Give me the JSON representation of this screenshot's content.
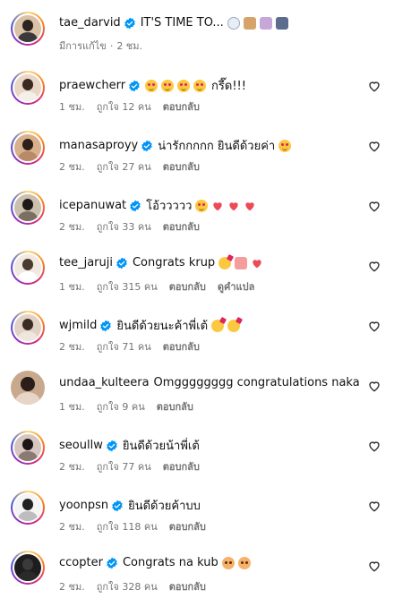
{
  "caption": {
    "username": "tae_darvid",
    "text": "IT'S TIME TO...",
    "edited": "มีการแก้ไข",
    "time": "2 ชม.",
    "emojis": [
      "ring",
      "couple",
      "bride",
      "groom"
    ]
  },
  "comments": [
    {
      "username": "praewcherr",
      "verified": true,
      "text": "กรี๊ด!!!",
      "emojis_before": [
        "face",
        "face",
        "face",
        "face"
      ],
      "emojis_after": [],
      "time": "1 ชม.",
      "likes": "ถูกใจ 12 คน",
      "reply": "ตอบกลับ",
      "translate": ""
    },
    {
      "username": "manasaproyy",
      "verified": true,
      "text": "น่ารักกกกก ยินดีด้วยค่า",
      "emojis_before": [],
      "emojis_after": [
        "face"
      ],
      "time": "2 ชม.",
      "likes": "ถูกใจ 27 คน",
      "reply": "ตอบกลับ",
      "translate": ""
    },
    {
      "username": "icepanuwat",
      "verified": true,
      "text": "โอ้ววววว",
      "emojis_before": [],
      "emojis_after": [
        "face",
        "heart",
        "heart",
        "heart"
      ],
      "time": "2 ชม.",
      "likes": "ถูกใจ 33 คน",
      "reply": "ตอบกลับ",
      "translate": ""
    },
    {
      "username": "tee_jaruji",
      "verified": true,
      "text": "Congrats krup",
      "emojis_before": [],
      "emojis_after": [
        "party",
        "kiss",
        "heart"
      ],
      "time": "1 ชม.",
      "likes": "ถูกใจ 315 คน",
      "reply": "ตอบกลับ",
      "translate": "ดูคำแปล"
    },
    {
      "username": "wjmild",
      "verified": true,
      "text": "ยินดีด้วยนะค้าพี่เต้",
      "emojis_before": [],
      "emojis_after": [
        "party",
        "party"
      ],
      "time": "2 ชม.",
      "likes": "ถูกใจ 71 คน",
      "reply": "ตอบกลับ",
      "translate": ""
    },
    {
      "username": "undaa_kulteera",
      "verified": false,
      "text": "Omgggggggg congratulations naka",
      "emojis_before": [],
      "emojis_after": [],
      "time": "1 ชม.",
      "likes": "ถูกใจ 9 คน",
      "reply": "ตอบกลับ",
      "translate": ""
    },
    {
      "username": "seoullw",
      "verified": true,
      "text": "ยินดีด้วยน้าพี่เต้",
      "emojis_before": [],
      "emojis_after": [],
      "time": "2 ชม.",
      "likes": "ถูกใจ 77 คน",
      "reply": "ตอบกลับ",
      "translate": ""
    },
    {
      "username": "yoonpsn",
      "verified": true,
      "text": "ยินดีด้วยค้าบบ",
      "emojis_before": [],
      "emojis_after": [],
      "time": "2 ชม.",
      "likes": "ถูกใจ 118 คน",
      "reply": "ตอบกลับ",
      "translate": ""
    },
    {
      "username": "ccopter",
      "verified": true,
      "text": "Congrats na kub",
      "emojis_before": [],
      "emojis_after": [
        "flush",
        "flush"
      ],
      "time": "2 ชม.",
      "likes": "ถูกใจ 328 คน",
      "reply": "ตอบกลับ",
      "translate": ""
    }
  ],
  "colors": {
    "verified_blue": "#0095f6",
    "heart_red": "#ed4956",
    "secondary_text": "#737373",
    "story_ring": [
      "#feda75",
      "#fa7e1e",
      "#d62976",
      "#962fbf",
      "#4f5bd5"
    ]
  },
  "icons": {
    "like": "heart-outline-icon",
    "verified": "verified-badge-icon"
  }
}
